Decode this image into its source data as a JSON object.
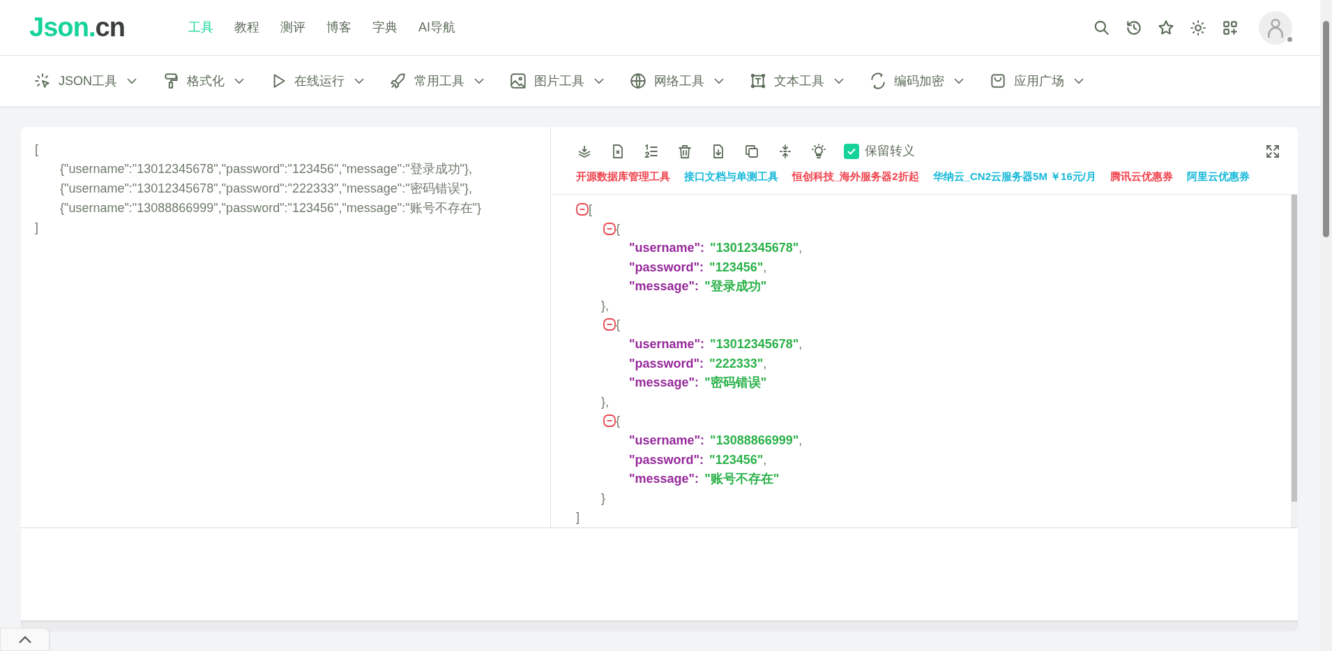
{
  "logo": {
    "part_1": "Json.",
    "part_2": "cn"
  },
  "top_nav": [
    {
      "label": "工具",
      "selected": true
    },
    {
      "label": "教程",
      "selected": false
    },
    {
      "label": "测评",
      "selected": false
    },
    {
      "label": "博客",
      "selected": false
    },
    {
      "label": "字典",
      "selected": false
    },
    {
      "label": "AI导航",
      "selected": false
    }
  ],
  "tool_menu": [
    {
      "label": "JSON工具"
    },
    {
      "label": "格式化"
    },
    {
      "label": "在线运行"
    },
    {
      "label": "常用工具"
    },
    {
      "label": "图片工具"
    },
    {
      "label": "网络工具"
    },
    {
      "label": "文本工具"
    },
    {
      "label": "编码加密"
    },
    {
      "label": "应用广场"
    }
  ],
  "input_editor": {
    "open": "[",
    "items": [
      "{\"username\":\"13012345678\",\"password\":\"123456\",\"message\":\"登录成功\"},",
      "{\"username\":\"13012345678\",\"password\":\"222333\",\"message\":\"密码错误\"},",
      "{\"username\":\"13088866999\",\"password\":\"123456\",\"message\":\"账号不存在\"}"
    ],
    "close": "]"
  },
  "output_toolbar": {
    "escape_checkbox": {
      "label": "保留转义",
      "checked": true
    }
  },
  "ad_links": [
    {
      "label": "开源数据库管理工具",
      "color": "#f0434d"
    },
    {
      "label": "接口文档与单测工具",
      "color": "#16b9d9"
    },
    {
      "label": "恒创科技_海外服务器2折起",
      "color": "#f0434d"
    },
    {
      "label": "华纳云_CN2云服务器5M ￥16元/月",
      "color": "#16b9d9"
    },
    {
      "label": "腾讯云优惠券",
      "color": "#f0434d"
    },
    {
      "label": "阿里云优惠券",
      "color": "#16b9d9"
    }
  ],
  "tree": {
    "open": "[",
    "expanded": true,
    "close": "]",
    "children": [
      {
        "open": "{",
        "expanded": true,
        "close": "},",
        "fields": [
          {
            "key": "\"username\":",
            "value": "\"13012345678\"",
            "comma": ","
          },
          {
            "key": "\"password\":",
            "value": "\"123456\"",
            "comma": ","
          },
          {
            "key": "\"message\":",
            "value": "\"登录成功\""
          }
        ]
      },
      {
        "open": "{",
        "expanded": true,
        "close": "},",
        "fields": [
          {
            "key": "\"username\":",
            "value": "\"13012345678\"",
            "comma": ","
          },
          {
            "key": "\"password\":",
            "value": "\"222333\"",
            "comma": ","
          },
          {
            "key": "\"message\":",
            "value": "\"密码错误\""
          }
        ]
      },
      {
        "open": "{",
        "expanded": true,
        "close": "}",
        "fields": [
          {
            "key": "\"username\":",
            "value": "\"13088866999\"",
            "comma": ","
          },
          {
            "key": "\"password\":",
            "value": "\"123456\"",
            "comma": ","
          },
          {
            "key": "\"message\":",
            "value": "\"账号不存在\""
          }
        ]
      }
    ]
  }
}
